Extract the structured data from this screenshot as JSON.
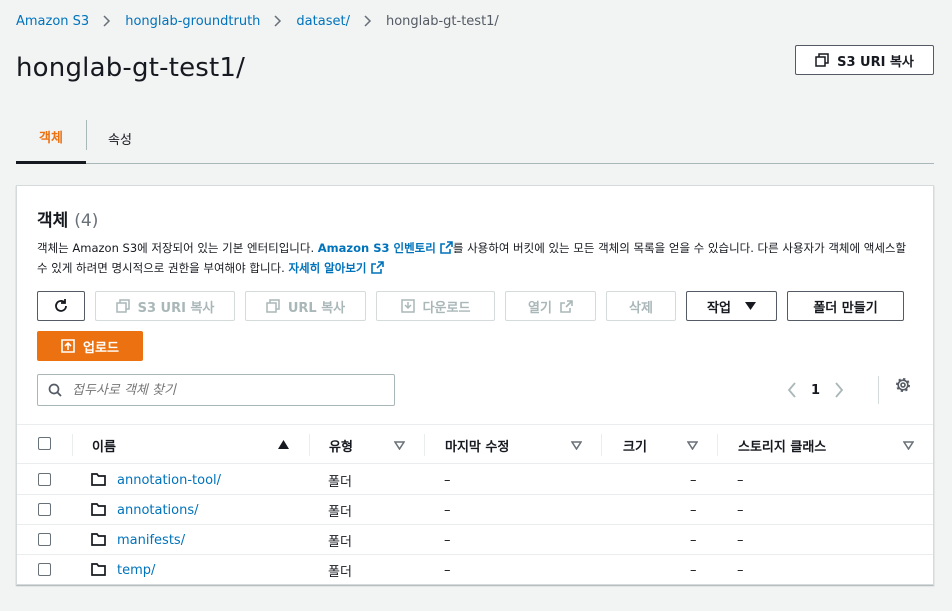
{
  "breadcrumb": [
    "Amazon S3",
    "honglab-groundtruth",
    "dataset/",
    "honglab-gt-test1/"
  ],
  "page_title": "honglab-gt-test1/",
  "copy_uri_label": "S3 URI 복사",
  "tabs": [
    {
      "label": "객체",
      "active": true
    },
    {
      "label": "속성",
      "active": false
    }
  ],
  "objects": {
    "title": "객체",
    "count": "(4)",
    "desc_part1": "객체는 Amazon S3에 저장되어 있는 기본 엔터티입니다. ",
    "desc_link1": "Amazon S3 인벤토리",
    "desc_part2": "를 사용하여 버킷에 있는 모든 객체의 목록을 얻을 수 있습니다. 다른 사용자가 객체에 액세스할 수 있게 하려면 명시적으로 권한을 부여해야 합니다. ",
    "desc_link2": "자세히 알아보기",
    "toolbar": {
      "copy_s3_uri": "S3 URI 복사",
      "copy_url": "URL 복사",
      "download": "다운로드",
      "open": "열기",
      "delete": "삭제",
      "actions": "작업",
      "create_folder": "폴더 만들기",
      "upload": "업로드"
    },
    "search_placeholder": "접두사로 객체 찾기",
    "page_number": "1",
    "columns": [
      "이름",
      "유형",
      "마지막 수정",
      "크기",
      "스토리지 클래스"
    ],
    "rows": [
      {
        "name": "annotation-tool/",
        "type": "폴더",
        "modified": "–",
        "size": "–",
        "storage": "–"
      },
      {
        "name": "annotations/",
        "type": "폴더",
        "modified": "–",
        "size": "–",
        "storage": "–"
      },
      {
        "name": "manifests/",
        "type": "폴더",
        "modified": "–",
        "size": "–",
        "storage": "–"
      },
      {
        "name": "temp/",
        "type": "폴더",
        "modified": "–",
        "size": "–",
        "storage": "–"
      }
    ]
  },
  "colors": {
    "accent": "#ec7211",
    "link": "#0073bb",
    "text": "#16191f",
    "disabled": "#aab7b8",
    "background": "#f2f3f3"
  }
}
